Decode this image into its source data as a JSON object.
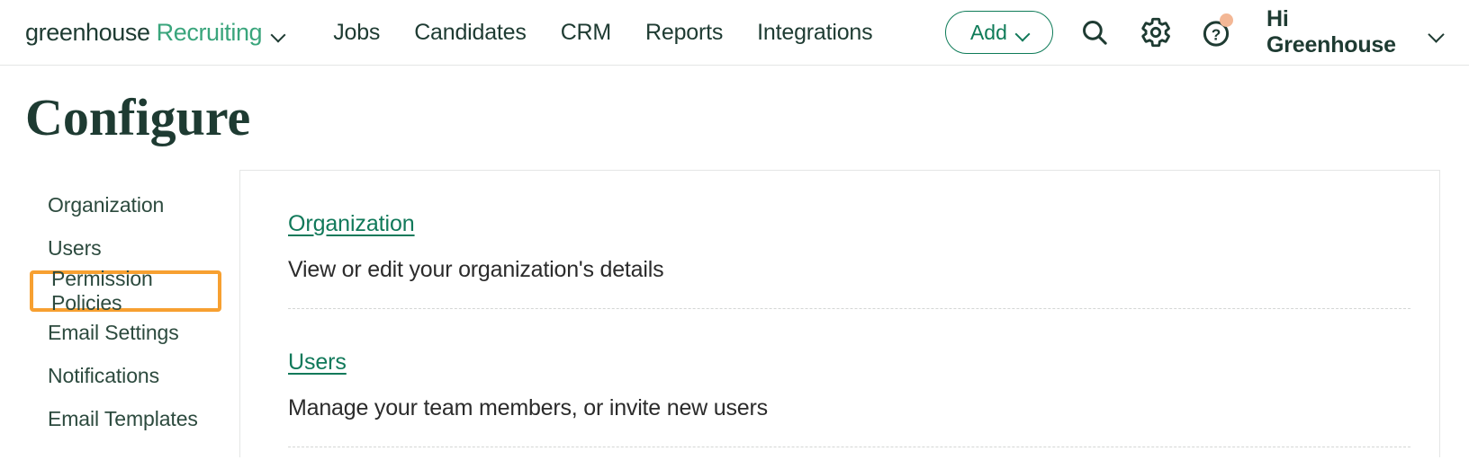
{
  "brand": {
    "name_dark": "greenhouse",
    "name_green": "Recruiting",
    "dropdown_icon": "chevron-down-icon"
  },
  "nav": {
    "links": [
      {
        "label": "Jobs"
      },
      {
        "label": "Candidates"
      },
      {
        "label": "CRM"
      },
      {
        "label": "Reports"
      },
      {
        "label": "Integrations"
      }
    ],
    "add_button": {
      "label": "Add",
      "icon": "chevron-down-icon",
      "color": "#0e7b58"
    },
    "icons": [
      {
        "name": "search-icon"
      },
      {
        "name": "gear-icon"
      },
      {
        "name": "help-icon",
        "badge": true,
        "badge_color": "#f3b795"
      }
    ],
    "account": {
      "label": "Hi Greenhouse",
      "icon": "chevron-down-icon"
    }
  },
  "page": {
    "title": "Configure"
  },
  "sidebar": {
    "items": [
      {
        "label": "Organization",
        "highlighted": false
      },
      {
        "label": "Users",
        "highlighted": false
      },
      {
        "label": "Permission Policies",
        "highlighted": true
      },
      {
        "label": "Email Settings",
        "highlighted": false
      },
      {
        "label": "Notifications",
        "highlighted": false
      },
      {
        "label": "Email Templates",
        "highlighted": false
      }
    ],
    "highlight_color": "#f7a031"
  },
  "main": {
    "sections": [
      {
        "link": "Organization",
        "description": "View or edit your organization's details"
      },
      {
        "link": "Users",
        "description": "Manage your team members, or invite new users"
      }
    ],
    "link_color": "#11795a"
  }
}
